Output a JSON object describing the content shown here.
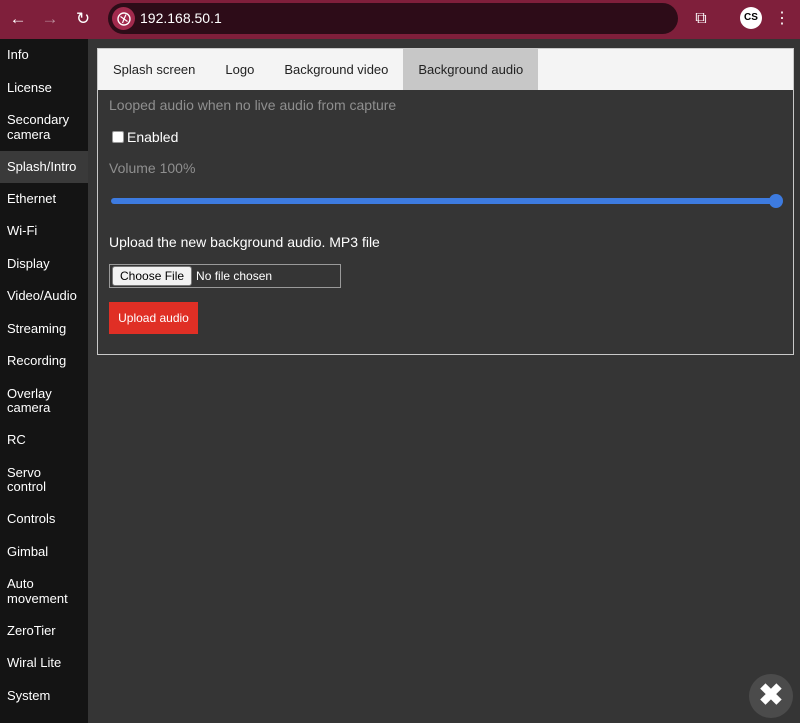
{
  "browser": {
    "url": "192.168.50.1",
    "profile_initials": "CS",
    "back_glyph": "←",
    "forward_glyph": "→",
    "reload_glyph": "↻",
    "extensions_glyph": "⧉",
    "menu_glyph": "⋮"
  },
  "sidebar": {
    "items": [
      {
        "label": "Info"
      },
      {
        "label": "License"
      },
      {
        "label": "Secondary camera"
      },
      {
        "label": "Splash/Intro",
        "active": true
      },
      {
        "label": "Ethernet"
      },
      {
        "label": "Wi-Fi"
      },
      {
        "label": "Display"
      },
      {
        "label": "Video/Audio"
      },
      {
        "label": "Streaming"
      },
      {
        "label": "Recording"
      },
      {
        "label": "Overlay camera"
      },
      {
        "label": "RC"
      },
      {
        "label": "Servo control"
      },
      {
        "label": "Controls"
      },
      {
        "label": "Gimbal"
      },
      {
        "label": "Auto movement"
      },
      {
        "label": "ZeroTier"
      },
      {
        "label": "Wiral Lite"
      },
      {
        "label": "System"
      }
    ]
  },
  "tabs": [
    {
      "label": "Splash screen"
    },
    {
      "label": "Logo"
    },
    {
      "label": "Background video"
    },
    {
      "label": "Background audio",
      "active": true
    }
  ],
  "background_audio": {
    "description": "Looped audio when no live audio from capture",
    "enabled_label": "Enabled",
    "enabled_checked": false,
    "volume_label": "Volume 100%",
    "volume_value": 1.0,
    "upload_label": "Upload the new background audio. MP3 file",
    "choose_file_label": "Choose File",
    "file_status": "No file chosen",
    "upload_button": "Upload audio"
  },
  "close_glyph": "✖",
  "colors": {
    "browser_frame": "#7f1f3b",
    "sidebar_bg": "#141414",
    "content_bg": "#353535",
    "accent_blue": "#3d7be0",
    "upload_red": "#e02f25"
  }
}
